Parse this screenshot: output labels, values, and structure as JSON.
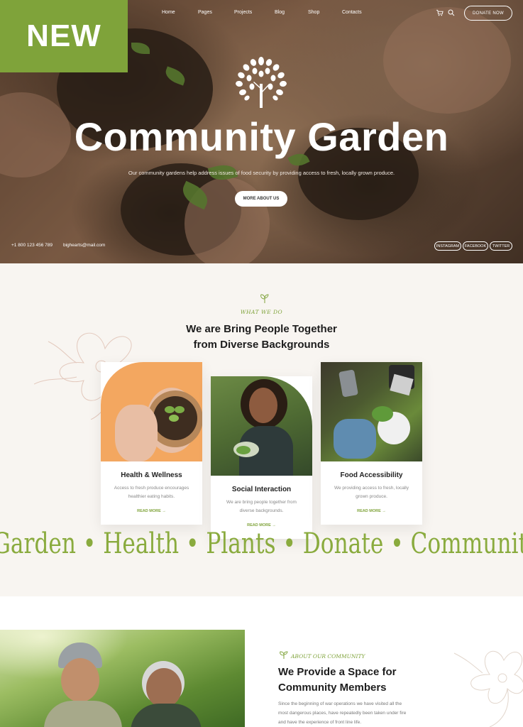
{
  "badge": {
    "label": "NEW"
  },
  "nav": {
    "items": [
      "Home",
      "Pages",
      "Projects",
      "Blog",
      "Shop",
      "Contacts"
    ],
    "donate_label": "DONATE NOW"
  },
  "hero": {
    "title": "Community Garden",
    "subtitle": "Our community gardens help address issues of food security by providing access to fresh, locally grown produce.",
    "cta_label": "MORE ABOUT US",
    "phone": "+1 800 123 456 789",
    "email": "bighearts@mail.com",
    "social": [
      "INSTAGRAM",
      "FACEBOOK",
      "TWITTER"
    ]
  },
  "what_we_do": {
    "eyebrow": "WHAT WE DO",
    "title_line1": "We are Bring People Together",
    "title_line2": "from Diverse Backgrounds",
    "cards": [
      {
        "title": "Health & Wellness",
        "desc_line1": "Access to fresh produce encourages",
        "desc_line2": "healthier eating habits.",
        "link": "READ MORE"
      },
      {
        "title": "Social Interaction",
        "desc_line1": "We are bring people together from",
        "desc_line2": "diverse backgrounds.",
        "link": "READ MORE"
      },
      {
        "title": "Food Accessibility",
        "desc_line1": "We providing access to fresh, locally",
        "desc_line2": "grown produce.",
        "link": "READ MORE"
      }
    ]
  },
  "marquee": {
    "text": "Garden • Health • Plants • Donate • Community • Food"
  },
  "about": {
    "eyebrow": "ABOUT OUR COMMUNITY",
    "title_line1": "We Provide a Space for",
    "title_line2": "Community Members",
    "text_line1": "Since the beginning of war operations we have visited all the",
    "text_line2": "most dangerous places, have repeatedly been taken under fire",
    "text_line3": "and have the experience of front line life."
  },
  "colors": {
    "accent": "#7fa33a",
    "cream": "#f8f5f1",
    "orange_card": "#f0a65a"
  }
}
